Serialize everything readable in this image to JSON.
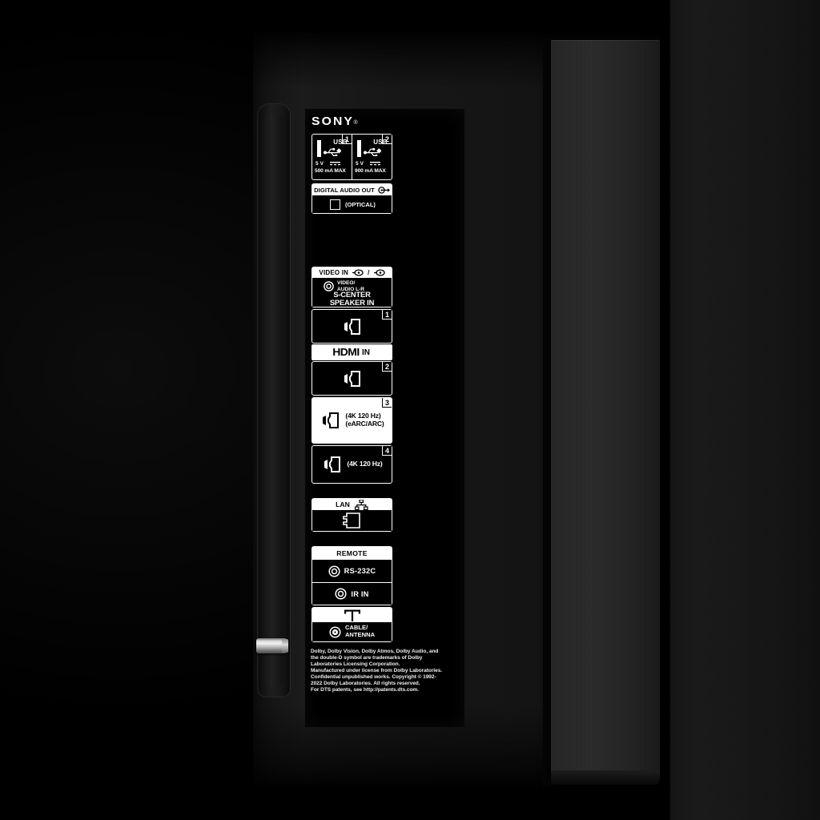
{
  "device": {
    "brand": "SONY",
    "registered_mark": "®",
    "panel_type": "rear-connector-label"
  },
  "usb": {
    "ports": [
      {
        "num": "1",
        "label": "USB",
        "volts": "5 V",
        "current": "500 mA MAX",
        "icon": "usb-icon",
        "dc_icon": "dc-power-icon"
      },
      {
        "num": "2",
        "label": "USB",
        "volts": "5 V",
        "current": "900 mA MAX",
        "icon": "usb-icon",
        "dc_icon": "dc-power-icon"
      }
    ]
  },
  "digital_audio_out": {
    "header": "DIGITAL AUDIO OUT",
    "header_icon": "optical-output-icon",
    "jack_label": "(OPTICAL)",
    "jack_icon": "optical-square-jack-icon"
  },
  "video_in": {
    "header": "VIDEO IN",
    "header_icons": [
      "composite-jack-icon",
      "composite-jack-icon"
    ],
    "separator": "/",
    "jack_icon": "rca-jack-icon",
    "sub_line1": "VIDEO/",
    "sub_line2": "AUDIO L-R",
    "center_line1": "S-CENTER",
    "center_line2": "SPEAKER IN"
  },
  "hdmi": {
    "wordmark": "HDMI",
    "in_label": "IN",
    "ports": [
      {
        "num": "1",
        "spec": "",
        "spec2": "",
        "inverted": false,
        "icon": "hdmi-port-icon"
      },
      {
        "num": "2",
        "spec": "",
        "spec2": "",
        "inverted": false,
        "icon": "hdmi-port-icon"
      },
      {
        "num": "3",
        "spec": "(4K 120 Hz)",
        "spec2": "(eARC/ARC)",
        "inverted": true,
        "icon": "hdmi-port-icon"
      },
      {
        "num": "4",
        "spec": "(4K 120 Hz)",
        "spec2": "",
        "inverted": false,
        "icon": "hdmi-port-icon"
      }
    ]
  },
  "lan": {
    "header": "LAN",
    "header_icon": "network-icon",
    "jack_icon": "rj45-jack-icon"
  },
  "remote": {
    "header": "REMOTE",
    "rows": [
      {
        "label": "RS-232C",
        "icon": "minijack-icon"
      },
      {
        "label": "IR IN",
        "icon": "minijack-icon"
      }
    ]
  },
  "antenna": {
    "header_icon": "antenna-icon",
    "jack_icon": "coaxial-jack-icon",
    "line1": "CABLE/",
    "line2": "ANTENNA"
  },
  "legal": {
    "lines": [
      "Dolby, Dolby Vision, Dolby Atmos, Dolby Audio, and",
      "the double-D symbol are trademarks of Dolby",
      "Laboratories Licensing Corporation.",
      "Manufactured under license from Dolby Laboratories.",
      "Confidential unpublished works. Copyright © 1992-",
      "2022 Dolby Laboratories. All rights reserved.",
      "For DTS patents, see http://patents.dts.com."
    ]
  },
  "colors": {
    "label_background": "#000000",
    "label_foreground": "#ffffff",
    "chassis": "#1a1a1a",
    "bay": "#161616",
    "standoff_metal": "#d8d8d8"
  }
}
